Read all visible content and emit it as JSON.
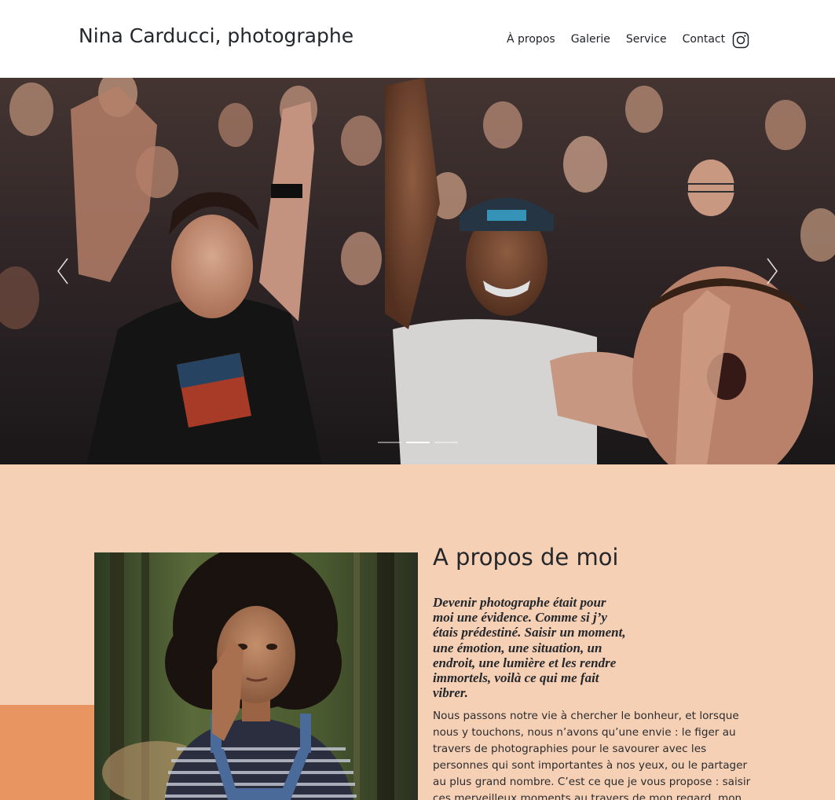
{
  "header": {
    "site_title": "Nina Carducci, photographe",
    "nav": [
      {
        "label": "À propos"
      },
      {
        "label": "Galerie"
      },
      {
        "label": "Service"
      },
      {
        "label": "Contact"
      }
    ],
    "social_icon": "instagram-icon"
  },
  "hero": {
    "slide_count": 3,
    "active_slide": 2,
    "prev_icon": "chevron-left-icon",
    "next_icon": "chevron-right-icon"
  },
  "about": {
    "title": "A propos de moi",
    "quote": "Devenir photographe était pour moi une évidence. Comme si j’y étais prédestiné. Saisir un moment, une émotion, une situation, un endroit, une lumière et les rendre immortels, voilà ce qui me fait vibrer.",
    "body": "Nous passons notre vie à chercher le bonheur, et lorsque nous y touchons, nous n’avons qu’une envie : le figer au travers de photographies pour le savourer avec les personnes qui sont importantes à nos yeux, ou le partager au plus grand nombre. C’est ce que je vous propose : saisir ces merveilleux moments au travers de mon regard, mon approche, ma"
  },
  "colors": {
    "section_background": "#f5d0b4",
    "accent": "#e89562",
    "text": "#24272c"
  }
}
